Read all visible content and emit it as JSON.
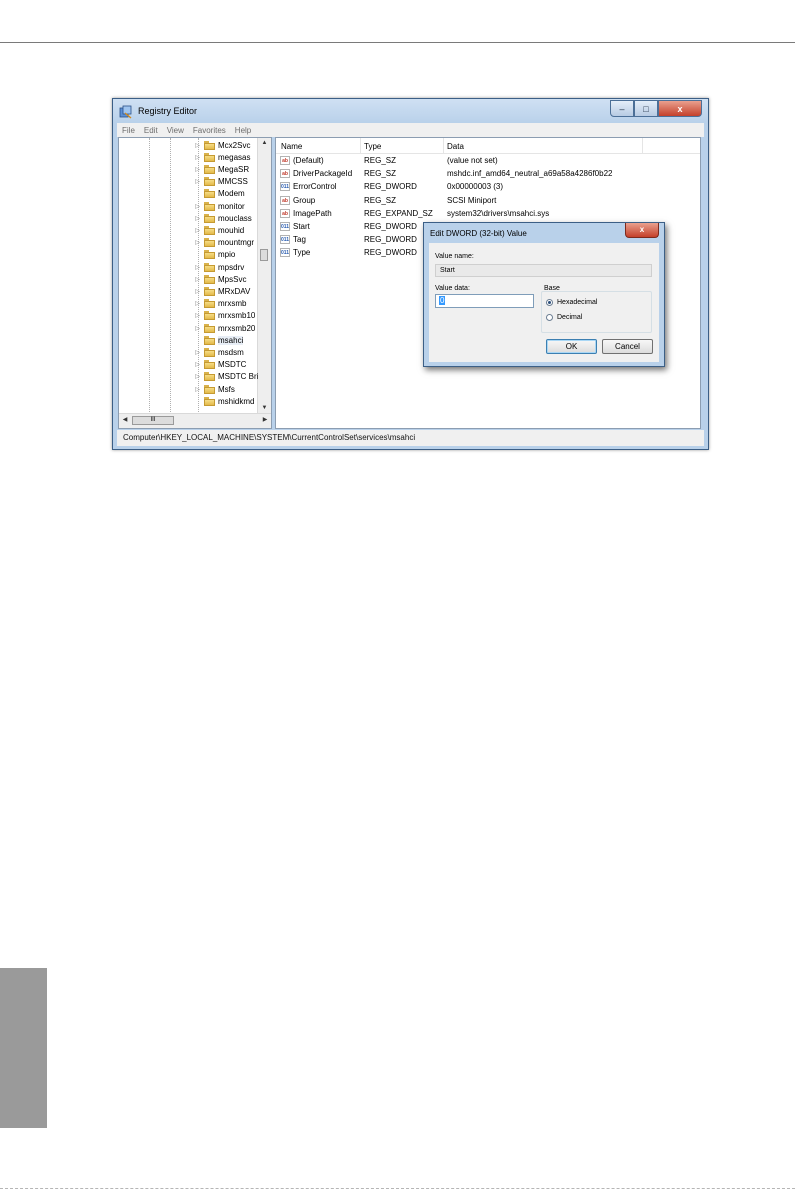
{
  "window": {
    "title": "Registry Editor",
    "menu": [
      "File",
      "Edit",
      "View",
      "Favorites",
      "Help"
    ],
    "caption_buttons": {
      "minimize": "–",
      "maximize": "□",
      "close": "x"
    }
  },
  "tree": {
    "items": [
      "Mcx2Svc",
      "megasas",
      "MegaSR",
      "MMCSS",
      "Modem",
      "monitor",
      "mouclass",
      "mouhid",
      "mountmgr",
      "mpio",
      "mpsdrv",
      "MpsSvc",
      "MRxDAV",
      "mrxsmb",
      "mrxsmb10",
      "mrxsmb20",
      "msahci",
      "msdsm",
      "MSDTC",
      "MSDTC Bri",
      "Msfs",
      "mshidkmd"
    ],
    "selected": "msahci",
    "scroll_thumb_glyph": "III"
  },
  "list": {
    "columns": [
      "Name",
      "Type",
      "Data"
    ],
    "rows": [
      {
        "icon": "string-value-icon",
        "icon_glyph": "ab",
        "name": "(Default)",
        "type": "REG_SZ",
        "data": "(value not set)"
      },
      {
        "icon": "string-value-icon",
        "icon_glyph": "ab",
        "name": "DriverPackageId",
        "type": "REG_SZ",
        "data": "mshdc.inf_amd64_neutral_a69a58a4286f0b22"
      },
      {
        "icon": "dword-value-icon",
        "icon_glyph": "011",
        "name": "ErrorControl",
        "type": "REG_DWORD",
        "data": "0x00000003 (3)"
      },
      {
        "icon": "string-value-icon",
        "icon_glyph": "ab",
        "name": "Group",
        "type": "REG_SZ",
        "data": "SCSI Miniport"
      },
      {
        "icon": "string-value-icon",
        "icon_glyph": "ab",
        "name": "ImagePath",
        "type": "REG_EXPAND_SZ",
        "data": "system32\\drivers\\msahci.sys"
      },
      {
        "icon": "dword-value-icon",
        "icon_glyph": "011",
        "name": "Start",
        "type": "REG_DWORD",
        "data": ""
      },
      {
        "icon": "dword-value-icon",
        "icon_glyph": "011",
        "name": "Tag",
        "type": "REG_DWORD",
        "data": ""
      },
      {
        "icon": "dword-value-icon",
        "icon_glyph": "011",
        "name": "Type",
        "type": "REG_DWORD",
        "data": ""
      }
    ]
  },
  "status_bar": "Computer\\HKEY_LOCAL_MACHINE\\SYSTEM\\CurrentControlSet\\services\\msahci",
  "dialog": {
    "title": "Edit DWORD (32-bit) Value",
    "close_glyph": "x",
    "value_name_label": "Value name:",
    "value_name": "Start",
    "value_data_label": "Value data:",
    "value_data": "0",
    "base_label": "Base",
    "base_options": [
      "Hexadecimal",
      "Decimal"
    ],
    "base_selected": "Hexadecimal",
    "ok_label": "OK",
    "cancel_label": "Cancel"
  },
  "colors": {
    "window_frame": "#b9d1ea",
    "close_button": "#c4402a",
    "selection": "#3399ff",
    "page_side_tab": "#9a9a9a"
  }
}
